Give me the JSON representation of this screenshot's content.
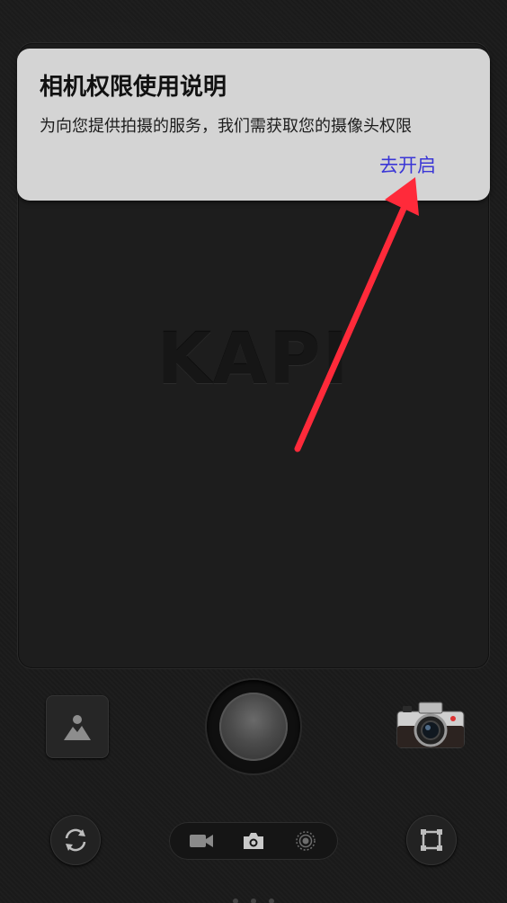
{
  "viewfinder": {
    "logo_text": "KAPI"
  },
  "permission_dialog": {
    "title": "相机权限使用说明",
    "message": "为向您提供拍摄的服务，我们需获取您的摄像头权限",
    "action_label": "去开启"
  },
  "controls": {
    "gallery_icon": "image-icon",
    "shutter_icon": "shutter-button",
    "camera_icon": "retro-camera-icon",
    "switch_icon": "switch-camera-icon",
    "crop_icon": "crop-frame-icon",
    "modes": [
      "video-icon",
      "photo-icon",
      "live-icon"
    ]
  },
  "colors": {
    "action": "#3a36d6",
    "arrow": "#ff2a3a",
    "dialog_bg": "#d4d4d4"
  }
}
